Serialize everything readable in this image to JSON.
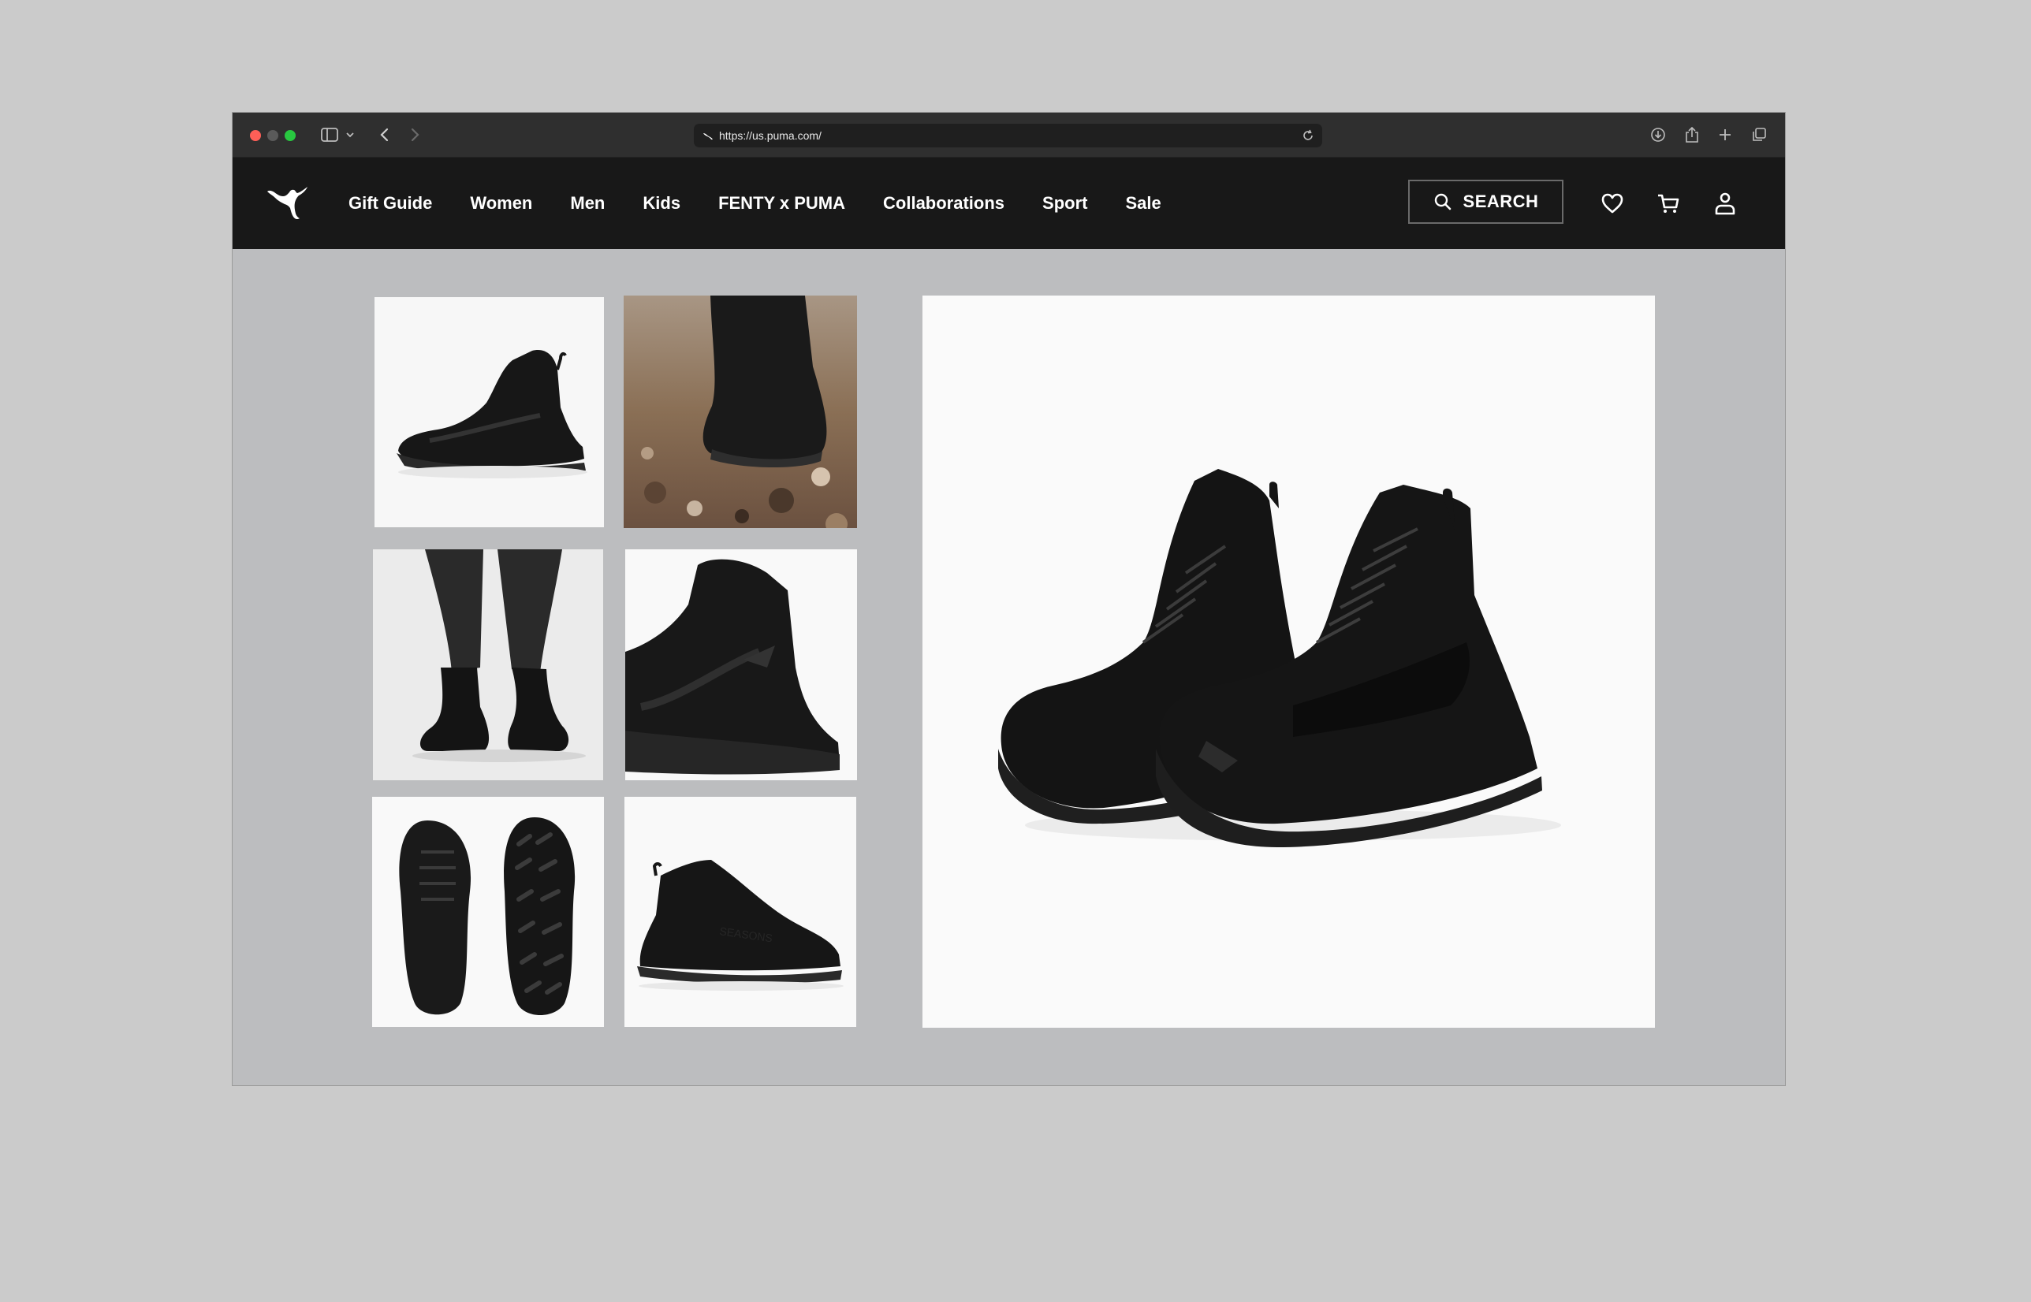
{
  "browser": {
    "url": "https://us.puma.com/"
  },
  "brand": {
    "logo": "puma-cat-logo"
  },
  "nav": {
    "links": [
      "Gift Guide",
      "Women",
      "Men",
      "Kids",
      "FENTY x PUMA",
      "Collaborations",
      "Sport",
      "Sale"
    ],
    "search_label": "SEARCH"
  },
  "gallery": {
    "thumbnails": [
      "shoe-side-view",
      "shoe-on-rocky-ground",
      "model-wearing-shoes",
      "heel-close-up",
      "top-and-sole-view",
      "shoe-medial-side"
    ],
    "hero": "pair-of-black-high-top-trail-shoes"
  },
  "colors": {
    "nav_bg": "#181818",
    "page_bg": "#bcbdbf",
    "shoe": "#161616"
  }
}
